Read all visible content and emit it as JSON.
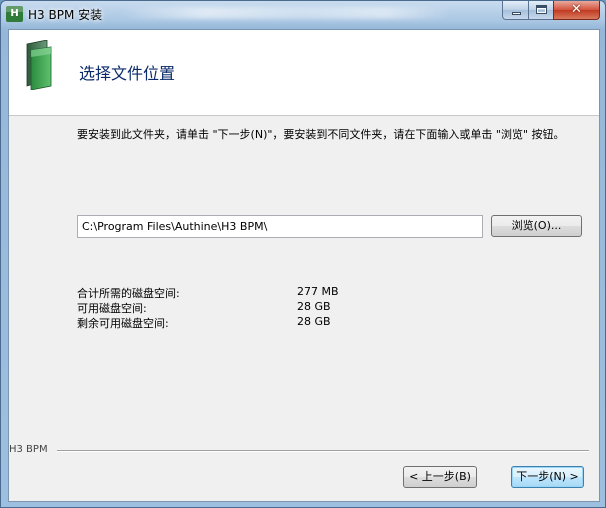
{
  "window": {
    "title": "H3 BPM 安装",
    "icon_text": "H"
  },
  "header": {
    "title": "选择文件位置"
  },
  "description": "要安装到此文件夹，请单击 \"下一步(N)\"，要安装到不同文件夹，请在下面输入或单击 \"浏览\" 按钮。",
  "install_path": {
    "value": "C:\\Program Files\\Authine\\H3 BPM\\"
  },
  "buttons": {
    "browse": "浏览(O)...",
    "back": "< 上一步(B)",
    "next": "下一步(N) >"
  },
  "disk_space": [
    {
      "label": "合计所需的磁盘空间:",
      "value": "277 MB"
    },
    {
      "label": "可用磁盘空间:",
      "value": "28 GB"
    },
    {
      "label": "剩余可用磁盘空间:",
      "value": "28 GB"
    }
  ],
  "footer": {
    "brand": "H3 BPM"
  },
  "icons": {
    "app": "h3-app-icon",
    "header": "folder-icon"
  },
  "colors": {
    "frame": "#9dbfe0",
    "close_button": "#c13a22",
    "header_title": "#0a2a6a"
  }
}
